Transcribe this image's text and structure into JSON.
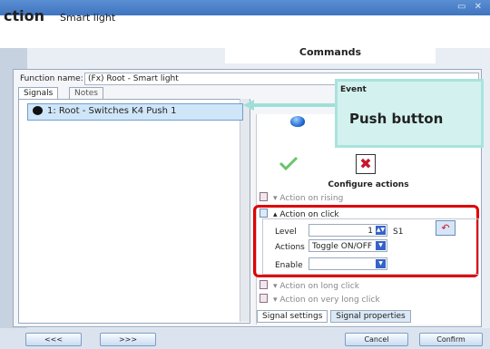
{
  "window": {
    "controls": "▭ ✕"
  },
  "header": {
    "title_bold": "ction",
    "title_sub": "Smart light"
  },
  "commands_tab": {
    "label": "Commands"
  },
  "function": {
    "label": "Function name:",
    "value": "(Fx) Root - Smart light"
  },
  "tabs": {
    "signals": "Signals",
    "notes": "Notes"
  },
  "signals": [
    {
      "label": "1: Root - Switches K4 Push 1"
    }
  ],
  "event_callout": {
    "title": "Event",
    "body": "Push button"
  },
  "configure": {
    "title": "Configure actions"
  },
  "actions": {
    "rising": "Action on rising",
    "click": "Action on click",
    "long_click": "Action on long click",
    "very_long_click": "Action on very long click"
  },
  "fields": {
    "level_label": "Level",
    "level_value": "1",
    "level_unit": "S1",
    "actions_label": "Actions",
    "actions_value": "Toggle ON/OFF",
    "enable_label": "Enable",
    "enable_value": ""
  },
  "bottom_tabs": {
    "signal_settings": "Signal settings",
    "signal_properties": "Signal properties"
  },
  "buttons": {
    "prev": "<<<",
    "next": ">>>",
    "cancel": "Cancel",
    "confirm": "Confirm"
  },
  "colors": {
    "highlight": "#e00000",
    "callout": "#d3f2ef",
    "accent": "#3f74bf"
  }
}
